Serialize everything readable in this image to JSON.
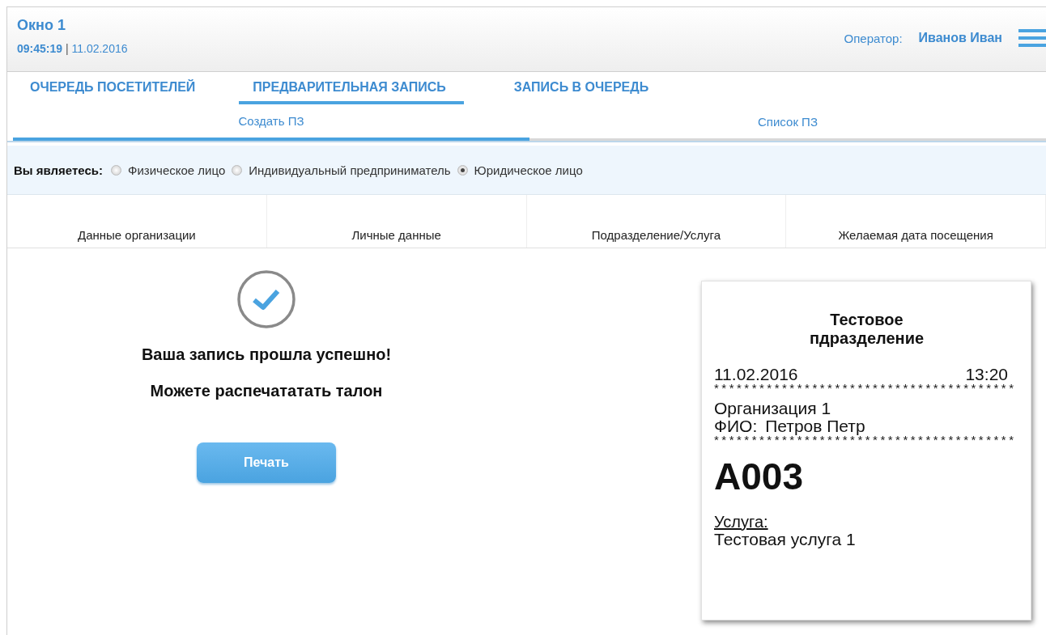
{
  "header": {
    "window_title": "Окно 1",
    "time": "09:45:19",
    "date": "11.02.2016",
    "clock_separator": "|",
    "operator_label": "Оператор:",
    "operator_name": "Иванов Иван"
  },
  "tabs": [
    {
      "label": "ОЧЕРЕДЬ ПОСЕТИТЕЛЕЙ",
      "selected": false
    },
    {
      "label": "ПРЕДВАРИТЕЛЬНАЯ ЗАПИСЬ",
      "selected": true
    },
    {
      "label": "ЗАПИСЬ В ОЧЕРЕДЬ",
      "selected": false
    }
  ],
  "subtabs": [
    {
      "label": "Создать ПЗ",
      "selected": true
    },
    {
      "label": "Список ПЗ",
      "selected": false
    }
  ],
  "client_type": {
    "label": "Вы являетесь:",
    "options": [
      {
        "label": "Физическое лицо",
        "selected": false
      },
      {
        "label": "Индивидуальный предприниматель",
        "selected": false
      },
      {
        "label": "Юридическое лицо",
        "selected": true
      }
    ]
  },
  "steps": [
    "Данные организации",
    "Личные данные",
    "Подразделение/Услуга",
    "Желаемая дата посещения"
  ],
  "result": {
    "title": "Ваша запись прошла успешно!",
    "subtitle": "Можете распечататать талон",
    "print_button": "Печать"
  },
  "ticket": {
    "department": "Тестовое пдразделение",
    "date": "11.02.2016",
    "time": "13:20",
    "separator": "****************************************",
    "organization": "Организация 1",
    "name_label": "ФИО:",
    "name": "Петров Петр",
    "number": "A003",
    "service_label": "Услуга:",
    "service": "Тестовая услуга 1"
  }
}
